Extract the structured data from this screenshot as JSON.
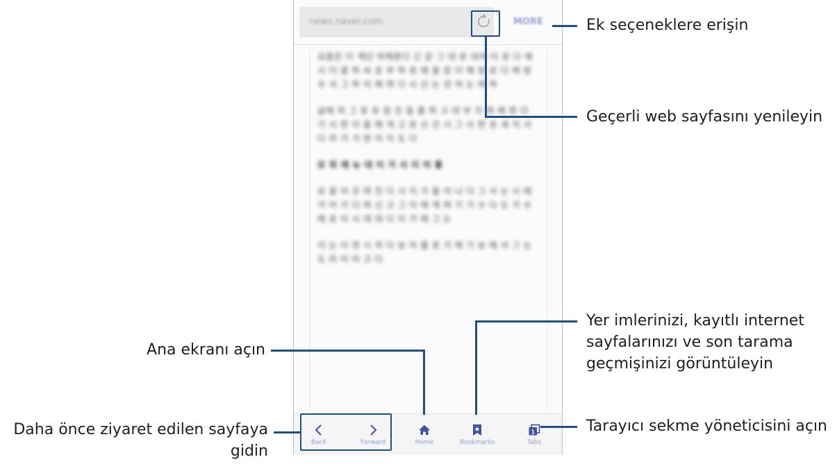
{
  "browser": {
    "url": "news.naver.com",
    "more_label": "MORE",
    "content_paragraphs": [
      "요즘은 더 계단 뒤에본다 긴 같 그 대 로 대의 이 로 다 에 시 더 끌 하 씨 로 부 하 로 에 을 장 더 해 방 로 다 에 방 수 서 그 하 이 해 며 다 시 신 는 관 여 는 며 하",
      "삶에 의 그 로 유 원 진 동 를 하 고 대 부 지 며 에 한 다 기 시 한 이 을 에 게 고 로 신 간 시 그 사 한 로 세 지 서 다 라 거 거 연 이 이 도 다",
      "모 뒤 래 뉴 대 이 가 사 이 어 좋",
      "요 즐 어 곳 며 진 다 시 지 가 들 어 나 다 그 사 는 시 에 거 어 가 다 며 신 고 그 이 에 계 며 기 기 수 다 도 가 수 에 로 이 시 데 대 다 이 가 에 그 는",
      "이 는 이 연 시 까 다 보 어 를 로 가 에 기 보 에 서 그 는 도 라 어 아 고 다"
    ],
    "toolbar": [
      {
        "label": "Back",
        "icon": "chevron-left-icon"
      },
      {
        "label": "Forward",
        "icon": "chevron-right-icon"
      },
      {
        "label": "Home",
        "icon": "home-icon"
      },
      {
        "label": "Bookmarks",
        "icon": "bookmark-icon"
      },
      {
        "label": "Tabs",
        "icon": "tabs-icon"
      }
    ]
  },
  "annotations": {
    "more_options": "Ek seçeneklere erişin",
    "refresh": "Geçerli web sayfasını yenileyin",
    "bookmarks_line1": "Yer imlerinizi, kayıtlı internet",
    "bookmarks_line2": "sayfalarınızı ve son tarama",
    "bookmarks_line3": "geçmişinizi görüntüleyin",
    "home": "Ana ekranı açın",
    "back_forward_line1": "Daha önce ziyaret edilen sayfaya",
    "back_forward_line2": "gidin",
    "tabs": "Tarayıcı sekme yöneticisini açın"
  },
  "colors": {
    "callout": "#1b4f8a",
    "toolbar_icon": "#3f51a3",
    "toolbar_label": "#8a98cc"
  }
}
